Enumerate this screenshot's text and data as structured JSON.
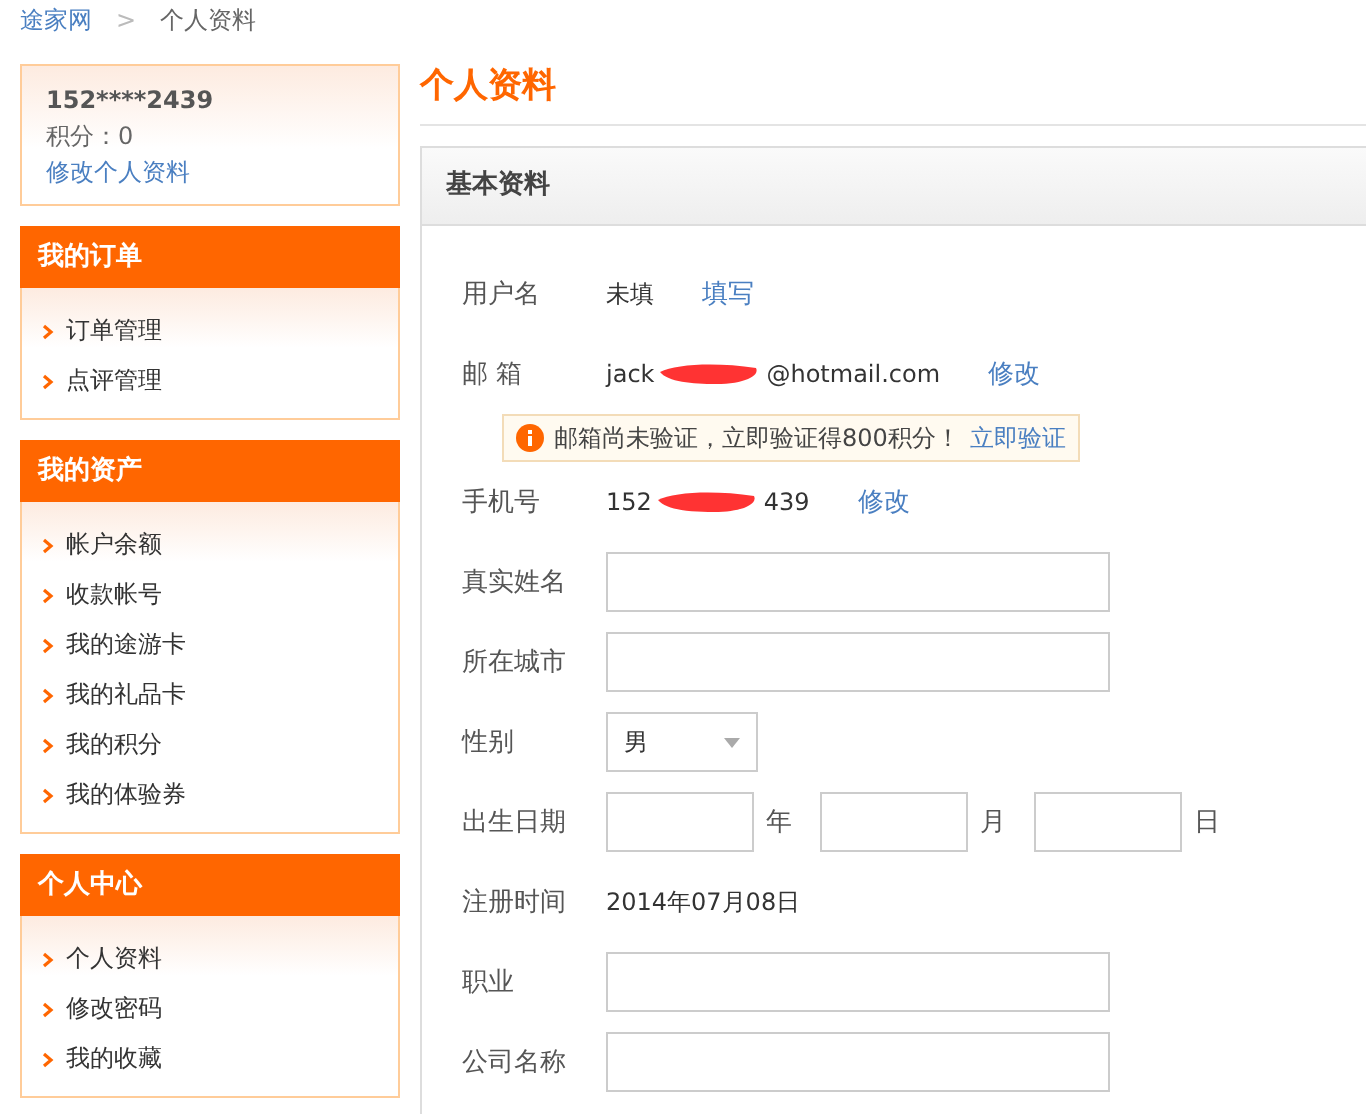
{
  "breadcrumb": {
    "home": "途家网",
    "separator": ">",
    "current": "个人资料"
  },
  "user": {
    "name": "152****2439",
    "points": "积分：0",
    "edit_link": "修改个人资料"
  },
  "sidebar": [
    {
      "title": "我的订单",
      "items": [
        {
          "label": "订单管理",
          "selected": false
        },
        {
          "label": "点评管理",
          "selected": false
        }
      ]
    },
    {
      "title": "我的资产",
      "items": [
        {
          "label": "帐户余额",
          "selected": false
        },
        {
          "label": "收款帐号",
          "selected": false
        },
        {
          "label": "我的途游卡",
          "selected": false
        },
        {
          "label": "我的礼品卡",
          "selected": false
        },
        {
          "label": "我的积分",
          "selected": false
        },
        {
          "label": "我的体验券",
          "selected": false
        }
      ]
    },
    {
      "title": "个人中心",
      "items": [
        {
          "label": "个人资料",
          "selected": false
        },
        {
          "label": "修改密码",
          "selected": false
        },
        {
          "label": "我的收藏",
          "selected": false
        }
      ]
    }
  ],
  "page_title": "个人资料",
  "panel_title": "基本资料",
  "form": [
    {
      "kind": "text",
      "label": "用户名",
      "value": "未填",
      "link": "填写"
    },
    {
      "kind": "redacted",
      "label": "邮 箱",
      "value_start": "jack",
      "value_end": "@hotmail.com",
      "link": "修改"
    },
    {
      "kind": "notice",
      "text": "邮箱尚未验证，立即验证得800积分！",
      "link": "立即验证"
    },
    {
      "kind": "redacted",
      "label": "手机号",
      "value_start": "152",
      "value_end": "439",
      "link": "修改"
    },
    {
      "kind": "input",
      "label": "真实姓名"
    },
    {
      "kind": "input",
      "label": "所在城市"
    },
    {
      "kind": "select",
      "label": "性别",
      "value": "男"
    },
    {
      "kind": "date",
      "label": "出生日期",
      "units": [
        "年",
        "月",
        "日"
      ]
    },
    {
      "kind": "text",
      "label": "注册时间",
      "value": "2014年07月08日"
    },
    {
      "kind": "input",
      "label": "职业"
    },
    {
      "kind": "input",
      "label": "公司名称"
    }
  ]
}
